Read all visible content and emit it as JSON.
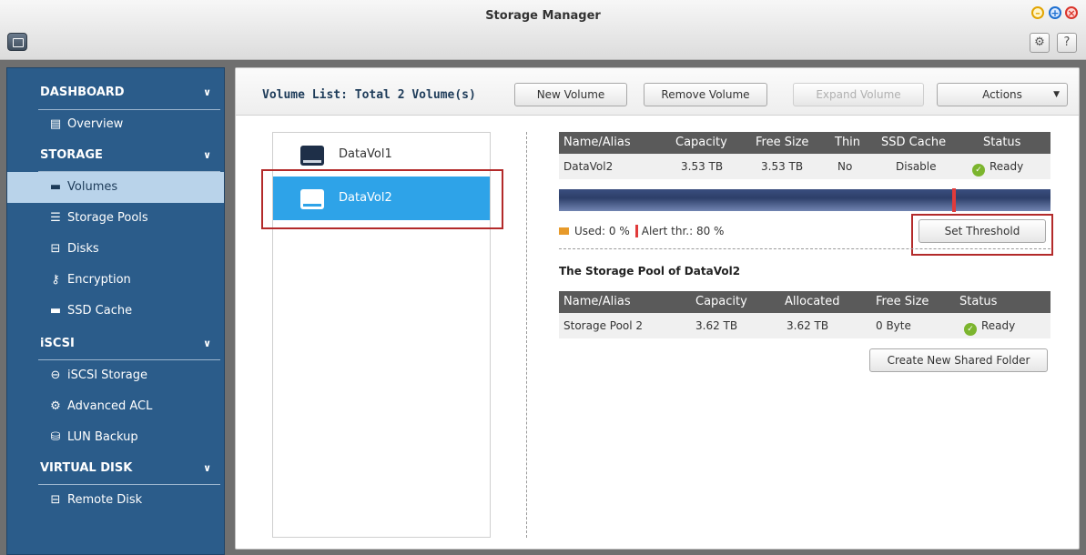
{
  "window": {
    "title": "Storage Manager"
  },
  "sidebar": {
    "sections": [
      {
        "label": "DASHBOARD",
        "items": [
          {
            "label": "Overview",
            "icon": "overview-icon"
          }
        ]
      },
      {
        "label": "STORAGE",
        "items": [
          {
            "label": "Volumes",
            "icon": "volume-icon",
            "active": true
          },
          {
            "label": "Storage Pools",
            "icon": "storage-pool-icon"
          },
          {
            "label": "Disks",
            "icon": "disk-icon"
          },
          {
            "label": "Encryption",
            "icon": "key-icon"
          },
          {
            "label": "SSD Cache",
            "icon": "ssd-cache-icon"
          }
        ]
      },
      {
        "label": "iSCSI",
        "items": [
          {
            "label": "iSCSI Storage",
            "icon": "iscsi-storage-icon"
          },
          {
            "label": "Advanced ACL",
            "icon": "gear-icon"
          },
          {
            "label": "LUN Backup",
            "icon": "backup-icon"
          }
        ]
      },
      {
        "label": "VIRTUAL DISK",
        "items": [
          {
            "label": "Remote Disk",
            "icon": "remote-disk-icon"
          }
        ]
      }
    ]
  },
  "main": {
    "title": "Volume List: Total 2 Volume(s)",
    "buttons": {
      "new_volume": "New Volume",
      "remove_volume": "Remove Volume",
      "expand_volume": "Expand Volume",
      "actions": "Actions"
    },
    "volumes": [
      {
        "name": "DataVol1",
        "selected": false
      },
      {
        "name": "DataVol2",
        "selected": true
      }
    ],
    "volume_table": {
      "headers": [
        "Name/Alias",
        "Capacity",
        "Free Size",
        "Thin",
        "SSD Cache",
        "Status"
      ],
      "row": [
        "DataVol2",
        "3.53 TB",
        "3.53 TB",
        "No",
        "Disable",
        "Ready"
      ]
    },
    "usage": {
      "used_label": "Used: 0 %",
      "alert_label": "Alert thr.: 80 %",
      "used_fraction": 0,
      "alert_fraction": 0.8
    },
    "set_threshold": "Set Threshold",
    "pool_title": "The Storage Pool of DataVol2",
    "pool_table": {
      "headers": [
        "Name/Alias",
        "Capacity",
        "Allocated",
        "Free Size",
        "Status"
      ],
      "row": [
        "Storage Pool 2",
        "3.62 TB",
        "3.62 TB",
        "0 Byte",
        "Ready"
      ]
    },
    "create_shared_folder": "Create New Shared Folder"
  },
  "colors": {
    "sidebar_bg": "#2b5c8a",
    "sidebar_active": "#b9d3ea",
    "selection_blue": "#2ea3e8",
    "highlight_red": "#b32a2a",
    "ready_green": "#7cb52e"
  }
}
